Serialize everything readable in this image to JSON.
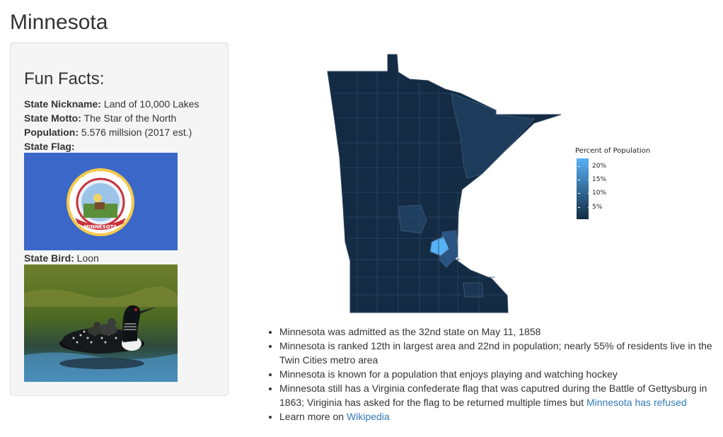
{
  "page": {
    "title": "Minnesota"
  },
  "sidebar": {
    "heading": "Fun Facts:",
    "nickname_label": "State Nickname:",
    "nickname_value": " Land of 10,000 Lakes",
    "motto_label": "State Motto:",
    "motto_value": " The Star of the North",
    "population_label": "Population:",
    "population_value": " 5.576 millsion (2017 est.)",
    "flag_label": "State Flag:",
    "flag_seal_text": "MINNESOTA",
    "bird_label": "State Bird:",
    "bird_value": " Loon"
  },
  "map": {
    "legend_title": "Percent of Population",
    "legend_ticks": [
      "20%",
      "15%",
      "10%",
      "5%"
    ],
    "colors": {
      "low": "#132b43",
      "high": "#56b1f7",
      "border": "#3a4a5c"
    }
  },
  "facts": {
    "item1": "Minnesota was admitted as the 32nd state on May 11, 1858",
    "item2": "Minnesota is ranked 12th in largest area and 22nd in population; nearly 55% of residents live in the Twin Cities metro area",
    "item3": "Minnesota is known for a population that enjoys playing and watching hockey",
    "item4_text": "Minnesota still has a Virginia confederate flag that was caputred during the Battle of Gettysburg in 1863; Viriginia has asked for the flag to be returned multiple times but ",
    "item4_link": "Minnesota has refused",
    "item5_text": "Learn more on ",
    "item5_link": "Wikipedia"
  }
}
